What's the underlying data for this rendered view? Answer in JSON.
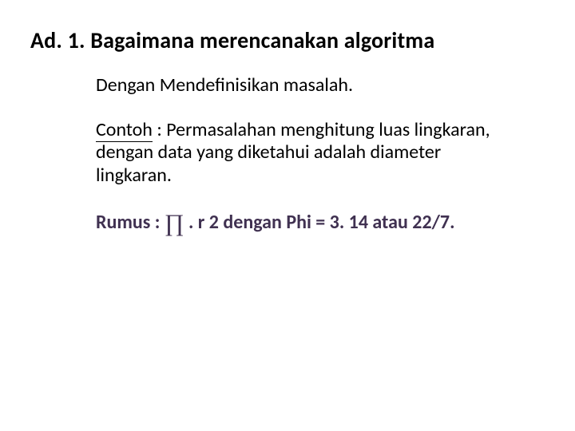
{
  "title": "Ad. 1. Bagaimana merencanakan algoritma",
  "line1": "Dengan Mendefinisikan masalah.",
  "contoh_label": "Contoh",
  "contoh_sep": " : ",
  "contoh_text": "Permasalahan menghitung luas lingkaran, dengan data yang diketahui adalah diameter lingkaran.",
  "rumus_prefix": "Rumus :  ",
  "rumus_symbol": "∏",
  "rumus_rest": " . r 2 dengan  Phi =  3. 14 atau 22/7."
}
